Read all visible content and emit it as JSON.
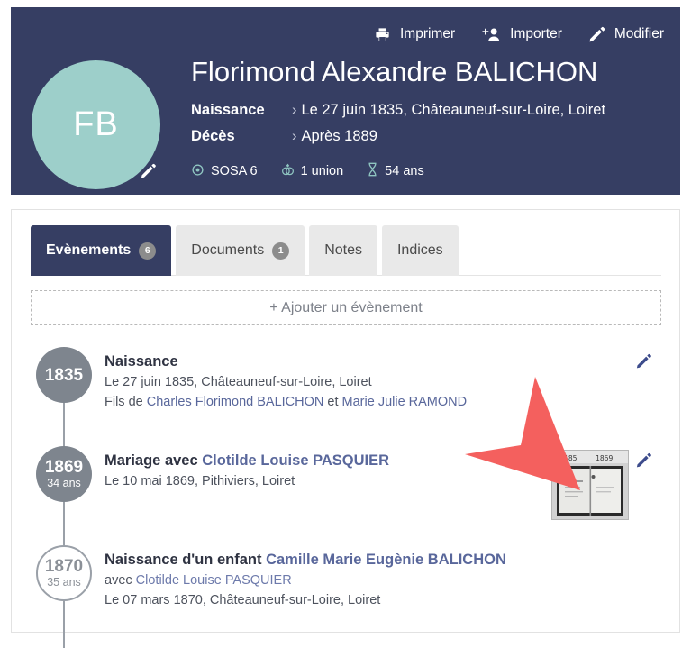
{
  "header": {
    "actions": [
      {
        "label": "Imprimer",
        "icon": "printer-icon"
      },
      {
        "label": "Importer",
        "icon": "person-plus-icon"
      },
      {
        "label": "Modifier",
        "icon": "pencil-icon"
      }
    ],
    "avatar_initials": "FB",
    "avatar_color": "#9dcfca",
    "banner_color": "#363e63",
    "person_name": "Florimond Alexandre BALICHON",
    "facts": [
      {
        "label": "Naissance",
        "chevron": "›",
        "value": "Le 27 juin 1835, Châteauneuf-sur-Loire, Loiret"
      },
      {
        "label": "Décès",
        "chevron": "›",
        "value": "Après 1889"
      }
    ],
    "meta": [
      {
        "icon": "sosa-target-icon",
        "label": "SOSA 6"
      },
      {
        "icon": "wedding-ring-icon",
        "label": "1 union"
      },
      {
        "icon": "hourglass-icon",
        "label": "54 ans"
      }
    ]
  },
  "tabs": [
    {
      "label": "Evènements",
      "count": "6",
      "active": true
    },
    {
      "label": "Documents",
      "count": "1",
      "active": false
    },
    {
      "label": "Notes",
      "count": "",
      "active": false
    },
    {
      "label": "Indices",
      "count": "",
      "active": false
    }
  ],
  "add_event_label": "+ Ajouter un évènement",
  "timeline": [
    {
      "year": "1835",
      "age": "",
      "hollow": false,
      "title": "Naissance",
      "title_link": "",
      "lines": [
        {
          "text": "Le 27 juin 1835, Châteauneuf-sur-Loire, Loiret"
        },
        {
          "prefix": "Fils de ",
          "link1": "Charles Florimond BALICHON",
          "middle": " et ",
          "link2": "Marie Julie RAMOND"
        }
      ],
      "has_document": false,
      "edit_icon": "pencil-icon"
    },
    {
      "year": "1869",
      "age": "34 ans",
      "hollow": false,
      "title": "Mariage avec ",
      "title_link": "Clotilde Louise PASQUIER",
      "lines": [
        {
          "text": "Le 10 mai 1869, Pithiviers, Loiret"
        }
      ],
      "has_document": true,
      "document_label": "1869",
      "edit_icon": "pencil-icon"
    },
    {
      "year": "1870",
      "age": "35 ans",
      "hollow": true,
      "title": "Naissance d'un enfant ",
      "title_link": "Camille Marie Eugènie BALICHON",
      "lines": [
        {
          "prefix": "avec ",
          "link1": "Clotilde Louise PASQUIER"
        },
        {
          "text": "Le 07 mars 1870, Châteauneuf-sur-Loire, Loiret"
        }
      ],
      "has_document": false,
      "edit_icon": "pencil-icon"
    }
  ],
  "annotation": {
    "arrow_color": "#f4605e",
    "name": "red-pointer-arrow"
  }
}
